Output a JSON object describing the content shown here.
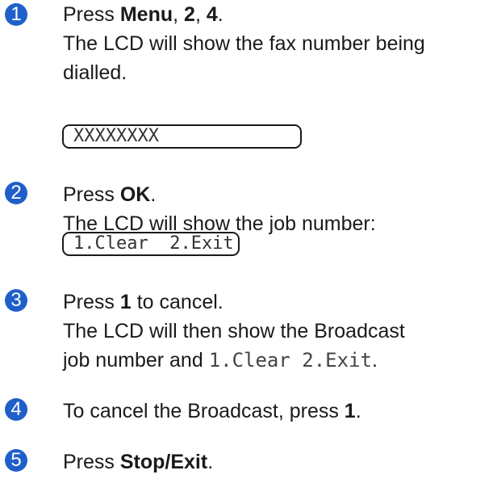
{
  "colors": {
    "step_circle": "#1f5fc9",
    "text": "#1a1a1a"
  },
  "steps": [
    {
      "number": "1",
      "lines": [
        {
          "prefix": "Press ",
          "bold1": "Menu",
          "sep1": ", ",
          "bold2": "2",
          "sep2": ", ",
          "bold3": "4",
          "suffix": "."
        },
        {
          "text": "The LCD will show the fax number being"
        },
        {
          "text": "dialled."
        }
      ],
      "lcd": "XXXXXXXX"
    },
    {
      "number": "2",
      "lines": [
        {
          "prefix": "Press ",
          "bold": "OK",
          "suffix": "."
        },
        {
          "text": "The LCD will show the job number:"
        }
      ],
      "lcd": "1.Clear  2.Exit"
    },
    {
      "number": "3",
      "lines": [
        {
          "prefix": "Press ",
          "bold": "1",
          "suffix": " to cancel."
        },
        {
          "text": "The LCD will then show the Broadcast"
        },
        {
          "prefix": "job number and ",
          "mono": "1.Clear  2.Exit",
          "suffix": "."
        }
      ]
    },
    {
      "number": "4",
      "lines": [
        {
          "prefix": "To cancel the Broadcast, press ",
          "bold": "1",
          "suffix": "."
        }
      ]
    },
    {
      "number": "5",
      "lines": [
        {
          "prefix": "Press ",
          "bold": "Stop/Exit",
          "suffix": "."
        }
      ]
    }
  ]
}
